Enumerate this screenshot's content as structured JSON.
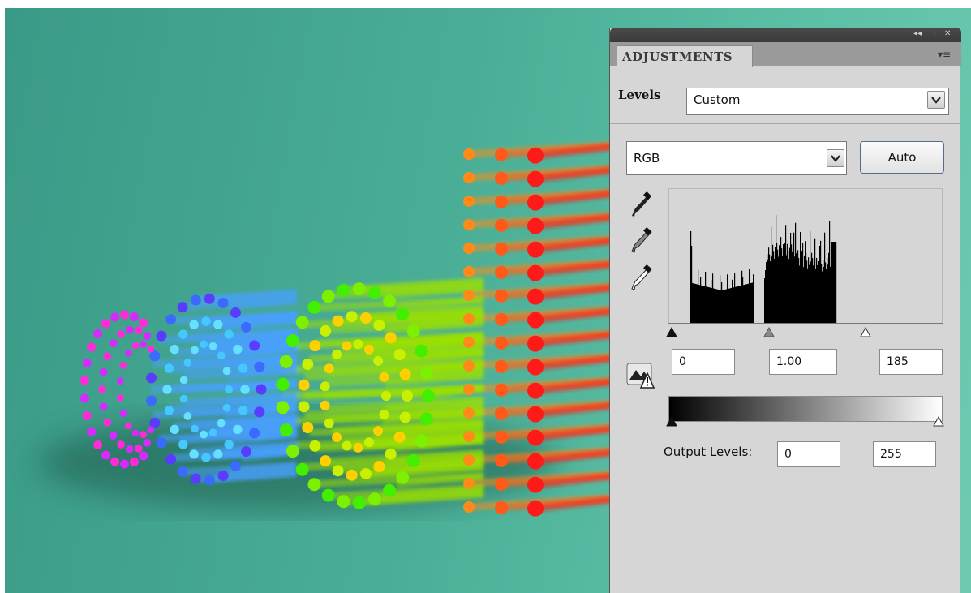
{
  "panel": {
    "tab_title": "ADJUSTMENTS",
    "collapse_glyph": "◂◂",
    "close_glyph": "✕",
    "menu_glyph": "▾≡"
  },
  "levels": {
    "label": "Levels",
    "preset_value": "Custom",
    "channel_value": "RGB",
    "auto_label": "Auto",
    "input_black": "0",
    "input_gamma": "1.00",
    "input_white": "185",
    "output_label": "Output Levels:",
    "output_black": "0",
    "output_white": "255"
  },
  "icons": {
    "black_eyedropper": "eyedropper-black-icon",
    "gray_eyedropper": "eyedropper-gray-icon",
    "white_eyedropper": "eyedropper-white-icon",
    "clip_warning": "clipping-warning-icon"
  },
  "colors": {
    "canvas_bg": "#4aae96",
    "panel_bg": "#d6d6d6",
    "panel_header": "#3f3f3f"
  }
}
